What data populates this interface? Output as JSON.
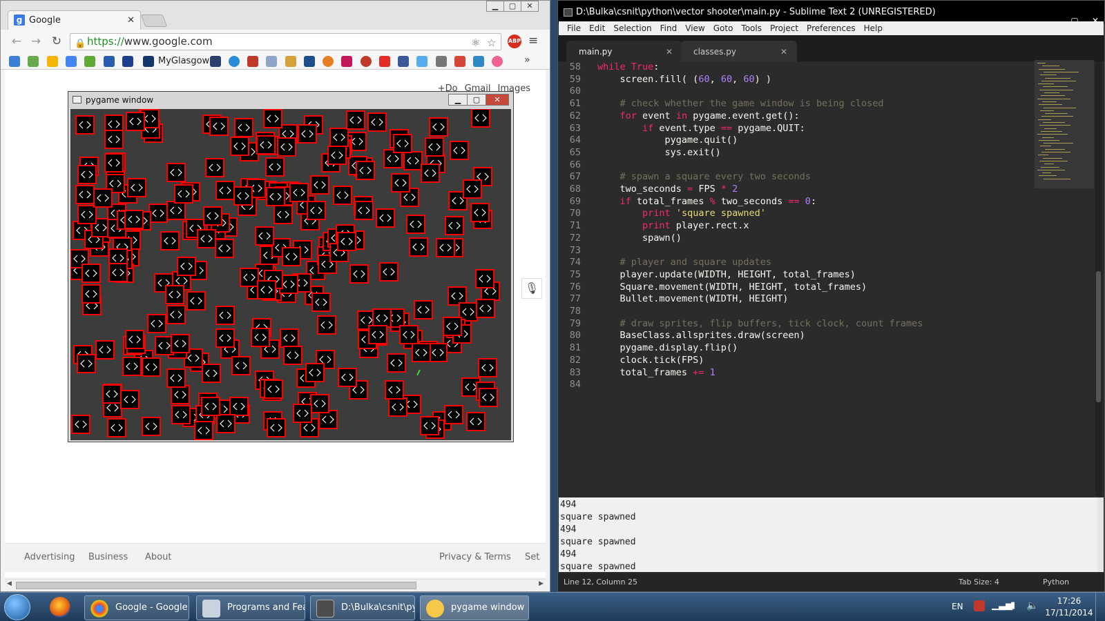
{
  "chrome": {
    "tab_title": "Google",
    "url_scheme": "https://",
    "url_rest": "www.google.com",
    "bookmark_label": "MyGlasgow",
    "abp_label": "ABP",
    "toplinks": [
      "+Do",
      "Gmail",
      "Images"
    ],
    "footer": {
      "advertising": "Advertising",
      "business": "Business",
      "about": "About",
      "privacy": "Privacy & Terms",
      "settings": "Set"
    }
  },
  "pygame": {
    "title": "pygame window",
    "bg_color": "#3c3c3c",
    "square_stroke": "#ff0000",
    "square_fill": "#000000"
  },
  "sublime": {
    "title": "D:\\Bulka\\csnit\\python\\vector shooter\\main.py - Sublime Text 2 (UNREGISTERED)",
    "menu": [
      "File",
      "Edit",
      "Selection",
      "Find",
      "View",
      "Goto",
      "Tools",
      "Project",
      "Preferences",
      "Help"
    ],
    "tabs": [
      {
        "label": "main.py",
        "active": true
      },
      {
        "label": "classes.py",
        "active": false
      }
    ],
    "code_lines": [
      {
        "n": "58",
        "tokens": [
          [
            "kw",
            "while"
          ],
          [
            "txt",
            " "
          ],
          [
            "kw",
            "True"
          ],
          [
            "txt",
            ":"
          ]
        ]
      },
      {
        "n": "59",
        "tokens": [
          [
            "txt",
            "    screen.fill( ("
          ],
          [
            "num",
            "60"
          ],
          [
            "txt",
            ", "
          ],
          [
            "num",
            "60"
          ],
          [
            "txt",
            ", "
          ],
          [
            "num",
            "60"
          ],
          [
            "txt",
            ") )"
          ]
        ]
      },
      {
        "n": "60",
        "tokens": []
      },
      {
        "n": "61",
        "tokens": [
          [
            "cm",
            "    # check whether the game window is being closed"
          ]
        ]
      },
      {
        "n": "62",
        "tokens": [
          [
            "txt",
            "    "
          ],
          [
            "kw",
            "for"
          ],
          [
            "txt",
            " event "
          ],
          [
            "kw",
            "in"
          ],
          [
            "txt",
            " pygame.event.get():"
          ]
        ]
      },
      {
        "n": "63",
        "tokens": [
          [
            "txt",
            "        "
          ],
          [
            "kw",
            "if"
          ],
          [
            "txt",
            " event.type "
          ],
          [
            "kw",
            "=="
          ],
          [
            "txt",
            " pygame.QUIT:"
          ]
        ]
      },
      {
        "n": "64",
        "tokens": [
          [
            "txt",
            "            pygame.quit()"
          ]
        ]
      },
      {
        "n": "65",
        "tokens": [
          [
            "txt",
            "            sys.exit()"
          ]
        ]
      },
      {
        "n": "66",
        "tokens": []
      },
      {
        "n": "67",
        "tokens": [
          [
            "cm",
            "    # spawn a square every two seconds"
          ]
        ]
      },
      {
        "n": "68",
        "tokens": [
          [
            "txt",
            "    two_seconds "
          ],
          [
            "kw",
            "="
          ],
          [
            "txt",
            " FPS "
          ],
          [
            "kw",
            "*"
          ],
          [
            "txt",
            " "
          ],
          [
            "num",
            "2"
          ]
        ]
      },
      {
        "n": "69",
        "tokens": [
          [
            "txt",
            "    "
          ],
          [
            "kw",
            "if"
          ],
          [
            "txt",
            " total_frames "
          ],
          [
            "kw",
            "%"
          ],
          [
            "txt",
            " two_seconds "
          ],
          [
            "kw",
            "=="
          ],
          [
            "txt",
            " "
          ],
          [
            "num",
            "0"
          ],
          [
            "txt",
            ":"
          ]
        ]
      },
      {
        "n": "70",
        "tokens": [
          [
            "txt",
            "        "
          ],
          [
            "kw",
            "print"
          ],
          [
            "txt",
            " "
          ],
          [
            "str",
            "'square spawned'"
          ]
        ]
      },
      {
        "n": "71",
        "tokens": [
          [
            "txt",
            "        "
          ],
          [
            "kw",
            "print"
          ],
          [
            "txt",
            " player.rect.x"
          ]
        ]
      },
      {
        "n": "72",
        "tokens": [
          [
            "txt",
            "        spawn()"
          ]
        ]
      },
      {
        "n": "73",
        "tokens": []
      },
      {
        "n": "74",
        "tokens": [
          [
            "cm",
            "    # player and square updates"
          ]
        ]
      },
      {
        "n": "75",
        "tokens": [
          [
            "txt",
            "    player.update(WIDTH, HEIGHT, total_frames)"
          ]
        ]
      },
      {
        "n": "76",
        "tokens": [
          [
            "txt",
            "    Square.movement(WIDTH, HEIGHT, total_frames)"
          ]
        ]
      },
      {
        "n": "77",
        "tokens": [
          [
            "txt",
            "    Bullet.movement(WIDTH, HEIGHT)"
          ]
        ]
      },
      {
        "n": "78",
        "tokens": []
      },
      {
        "n": "79",
        "tokens": [
          [
            "cm",
            "    # draw sprites, flip buffers, tick clock, count frames"
          ]
        ]
      },
      {
        "n": "80",
        "tokens": [
          [
            "txt",
            "    BaseClass.allsprites.draw(screen)"
          ]
        ]
      },
      {
        "n": "81",
        "tokens": [
          [
            "txt",
            "    pygame.display.flip()"
          ]
        ]
      },
      {
        "n": "82",
        "tokens": [
          [
            "txt",
            "    clock.tick(FPS)"
          ]
        ]
      },
      {
        "n": "83",
        "tokens": [
          [
            "txt",
            "    total_frames "
          ],
          [
            "kw",
            "+="
          ],
          [
            "txt",
            " "
          ],
          [
            "num",
            "1"
          ]
        ]
      },
      {
        "n": "84",
        "tokens": []
      }
    ],
    "console_lines": [
      "494",
      "square spawned",
      "494",
      "square spawned",
      "494",
      "square spawned"
    ],
    "status_position": "Line 12, Column 25",
    "status_tabsize": "Tab Size: 4",
    "status_syntax": "Python"
  },
  "taskbar": {
    "tasks": [
      {
        "label": "Google - Google ...",
        "icon": "chrome-icon"
      },
      {
        "label": "Programs and Fea...",
        "icon": "control-panel-icon"
      },
      {
        "label": "D:\\Bulka\\csnit\\py...",
        "icon": "sublime-icon"
      },
      {
        "label": "pygame window",
        "icon": "pygame-icon"
      }
    ],
    "lang": "EN",
    "time": "17:26",
    "date": "17/11/2014"
  }
}
